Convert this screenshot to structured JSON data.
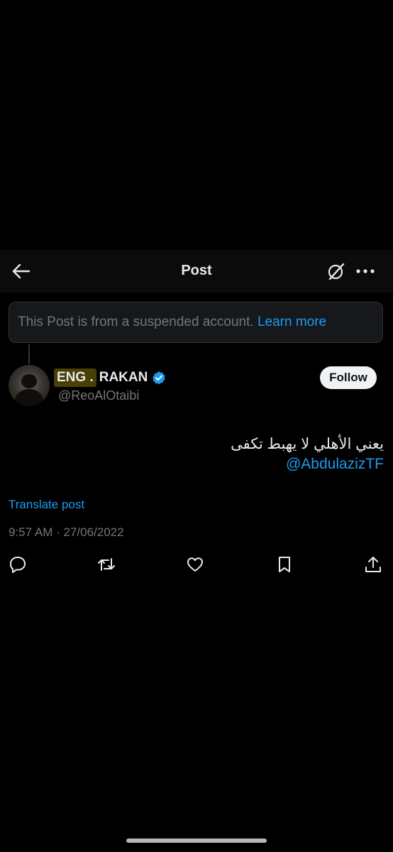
{
  "header": {
    "title": "Post",
    "back_icon": "arrow-left-icon",
    "grok_icon": "grok-icon",
    "more_icon": "more-horizontal-icon"
  },
  "notice": {
    "text": "This Post is from a suspended account.",
    "link": "Learn more"
  },
  "author": {
    "name_highlight": "ENG .",
    "name_rest": "RAKAN",
    "handle": "@ReoAlOtaibi",
    "verified": true,
    "follow_label": "Follow"
  },
  "post": {
    "text": "يعني الأهلي لا يهبط تكفى",
    "mention": "@AbdulazizTF",
    "translate": "Translate post",
    "timestamp": "9:57 AM · 27/06/2022"
  },
  "actions": [
    "reply-icon",
    "repost-icon",
    "like-icon",
    "bookmark-icon",
    "share-icon"
  ],
  "colors": {
    "background": "#000000",
    "accent": "#1d9bf0",
    "text": "#e7e9ea",
    "muted": "#71767b"
  }
}
